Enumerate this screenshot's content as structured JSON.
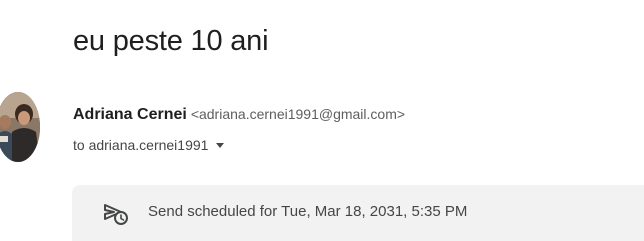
{
  "email": {
    "subject": "eu peste 10 ani",
    "sender": {
      "name": "Adriana Cernei",
      "email": "<adriana.cernei1991@gmail.com>"
    },
    "recipient_label": "to adriana.cernei1991",
    "scheduled_banner": {
      "text": "Send scheduled for Tue, Mar 18, 2031, 5:35 PM",
      "icon": "scheduled-send-icon"
    }
  },
  "colors": {
    "banner_background": "#f2f2f2",
    "text_primary": "#1f1f1f",
    "text_secondary": "#444746"
  }
}
